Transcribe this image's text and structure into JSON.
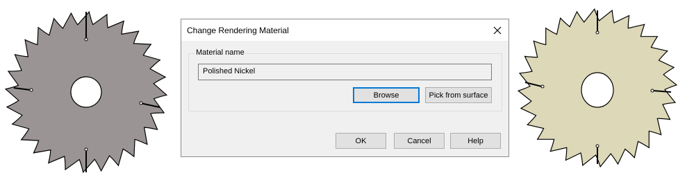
{
  "dialog": {
    "title": "Change Rendering Material",
    "material_group_label": "Material name",
    "material_value": "Polished Nickel",
    "browse_label": "Browse",
    "pick_label": "Pick from surface",
    "ok_label": "OK",
    "cancel_label": "Cancel",
    "help_label": "Help"
  },
  "colors": {
    "left_blade_fill": "#9a9594",
    "right_blade_fill": "#dcd8b8",
    "accent_focus": "#0078d7"
  }
}
